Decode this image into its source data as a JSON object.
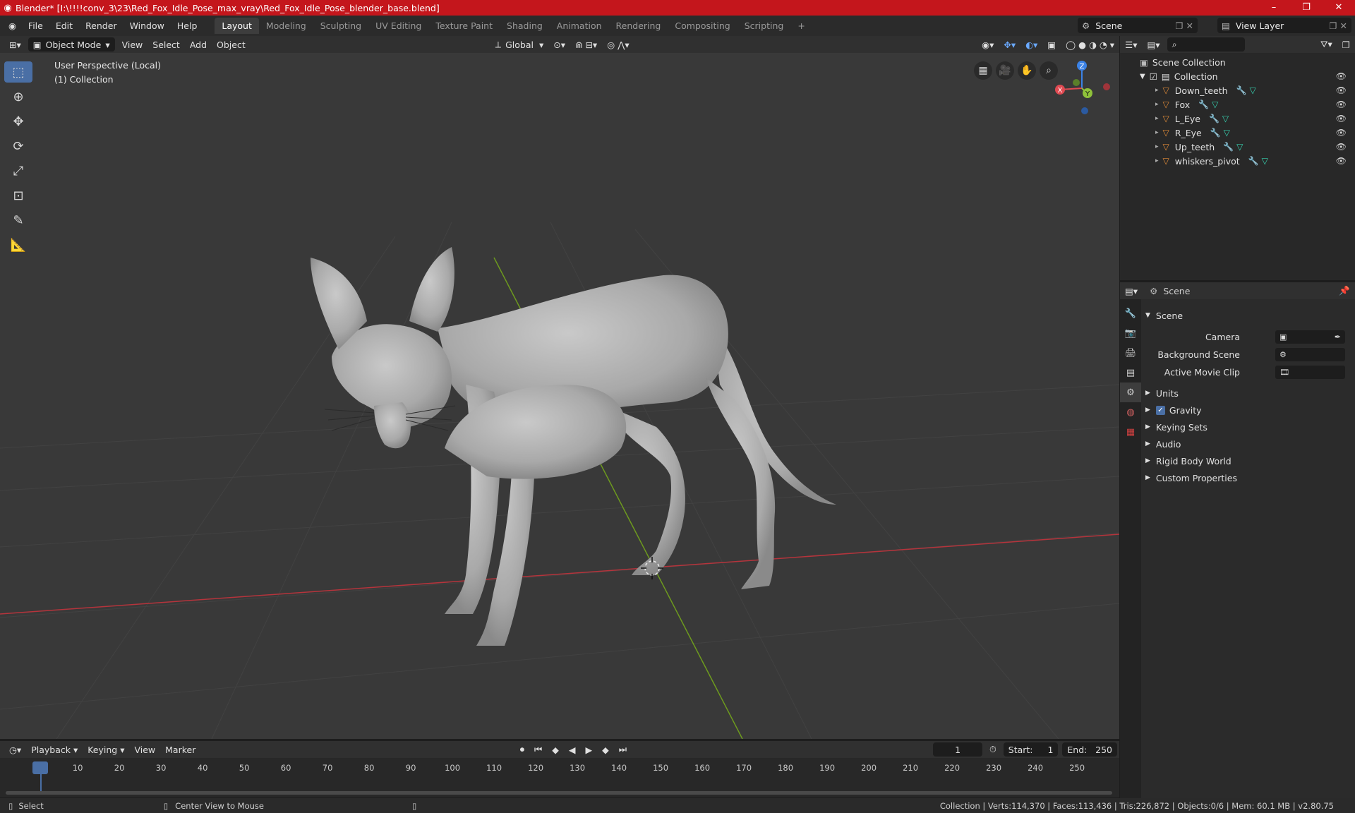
{
  "window": {
    "title": "Blender* [I:\\!!!!conv_3\\23\\Red_Fox_Idle_Pose_max_vray\\Red_Fox_Idle_Pose_blender_base.blend]",
    "minimize": "–",
    "maximize": "❐",
    "close": "✕"
  },
  "menu": [
    "File",
    "Edit",
    "Render",
    "Window",
    "Help"
  ],
  "workspaces": [
    "Layout",
    "Modeling",
    "Sculpting",
    "UV Editing",
    "Texture Paint",
    "Shading",
    "Animation",
    "Rendering",
    "Compositing",
    "Scripting"
  ],
  "active_workspace": "Layout",
  "scene_name": "Scene",
  "view_layer": "View Layer",
  "viewport_header": {
    "mode": "Object Mode",
    "menus": [
      "View",
      "Select",
      "Add",
      "Object"
    ],
    "orientation": "Global"
  },
  "viewport": {
    "perspective": "User Perspective (Local)",
    "collection": "(1) Collection",
    "gizmo": {
      "z": "Z",
      "y": "Y",
      "x": "X"
    }
  },
  "outliner": {
    "root": "Scene Collection",
    "collection": "Collection",
    "objects": [
      "Down_teeth",
      "Fox",
      "L_Eye",
      "R_Eye",
      "Up_teeth",
      "whiskers_pivot"
    ]
  },
  "properties": {
    "header": "Scene",
    "panel": "Scene",
    "fields": [
      {
        "label": "Camera",
        "value": ""
      },
      {
        "label": "Background Scene",
        "value": ""
      },
      {
        "label": "Active Movie Clip",
        "value": ""
      }
    ],
    "sections": [
      "Units",
      "Gravity",
      "Keying Sets",
      "Audio",
      "Rigid Body World",
      "Custom Properties"
    ],
    "gravity_checked": true
  },
  "timeline": {
    "menus": [
      "Playback",
      "Keying",
      "View",
      "Marker"
    ],
    "current_frame": "1",
    "start_label": "Start:",
    "start": "1",
    "end_label": "End:",
    "end": "250",
    "ticks": [
      "1",
      "10",
      "20",
      "30",
      "40",
      "50",
      "60",
      "70",
      "80",
      "90",
      "100",
      "110",
      "120",
      "130",
      "140",
      "150",
      "160",
      "170",
      "180",
      "190",
      "200",
      "210",
      "220",
      "230",
      "240",
      "250"
    ]
  },
  "status": {
    "left": "Select",
    "middle": "Center View to Mouse",
    "right": "Collection | Verts:114,370 | Faces:113,436 | Tris:226,872 | Objects:0/6 | Mem: 60.1 MB | v2.80.75"
  },
  "colors": {
    "title_bar": "#c4161c",
    "accent": "#4a6fa5",
    "x_axis": "#e04a52",
    "y_axis": "#8fc23a",
    "z_axis": "#3b82e6"
  }
}
